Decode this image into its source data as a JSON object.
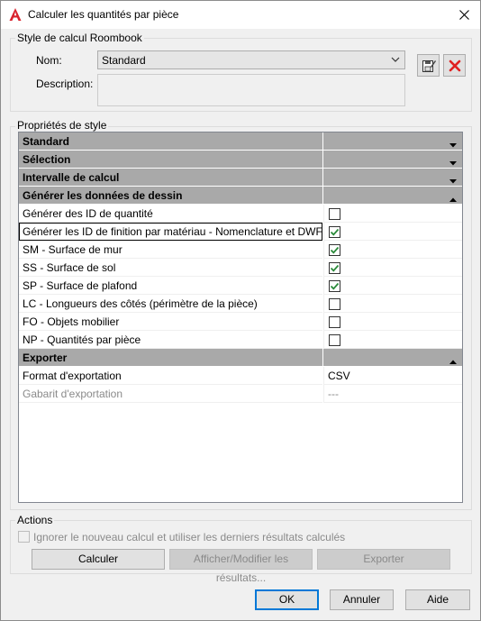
{
  "window": {
    "title": "Calculer les quantités par pièce"
  },
  "style_group": {
    "label": "Style de calcul Roombook",
    "name_label": "Nom:",
    "name_value": "Standard",
    "description_label": "Description:"
  },
  "properties_group": {
    "label": "Propriétés de style"
  },
  "grid": {
    "categories": {
      "standard": "Standard",
      "selection": "Sélection",
      "interval": "Intervalle de calcul",
      "drawing": "Générer les données de dessin",
      "export": "Exporter"
    },
    "drawing_rows": [
      {
        "label": "Générer des ID de quantité",
        "checked": false
      },
      {
        "label": "Générer les ID de finition par matériau - Nomenclature et DWF",
        "checked": true
      },
      {
        "label": "SM - Surface de mur",
        "checked": true
      },
      {
        "label": "SS - Surface de sol",
        "checked": true
      },
      {
        "label": "SP - Surface de plafond",
        "checked": true
      },
      {
        "label": "LC - Longueurs des côtés (périmètre de la pièce)",
        "checked": false
      },
      {
        "label": "FO - Objets mobilier",
        "checked": false
      },
      {
        "label": "NP - Quantités par pièce",
        "checked": false
      }
    ],
    "export_rows": [
      {
        "label": "Format d'exportation",
        "value": "CSV"
      },
      {
        "label": "Gabarit d'exportation",
        "value": "---"
      }
    ]
  },
  "actions": {
    "label": "Actions",
    "ignore_label": "Ignorer le nouveau calcul et utiliser les derniers résultats calculés",
    "calculate": "Calculer",
    "view_modify": "Afficher/Modifier les résultats...",
    "export": "Exporter"
  },
  "footer": {
    "ok": "OK",
    "cancel": "Annuler",
    "help": "Aide"
  },
  "colors": {
    "category_bg": "#a9a9a9",
    "check_green": "#2a8a3a",
    "delete_red": "#e02020",
    "accent": "#0078d7"
  }
}
